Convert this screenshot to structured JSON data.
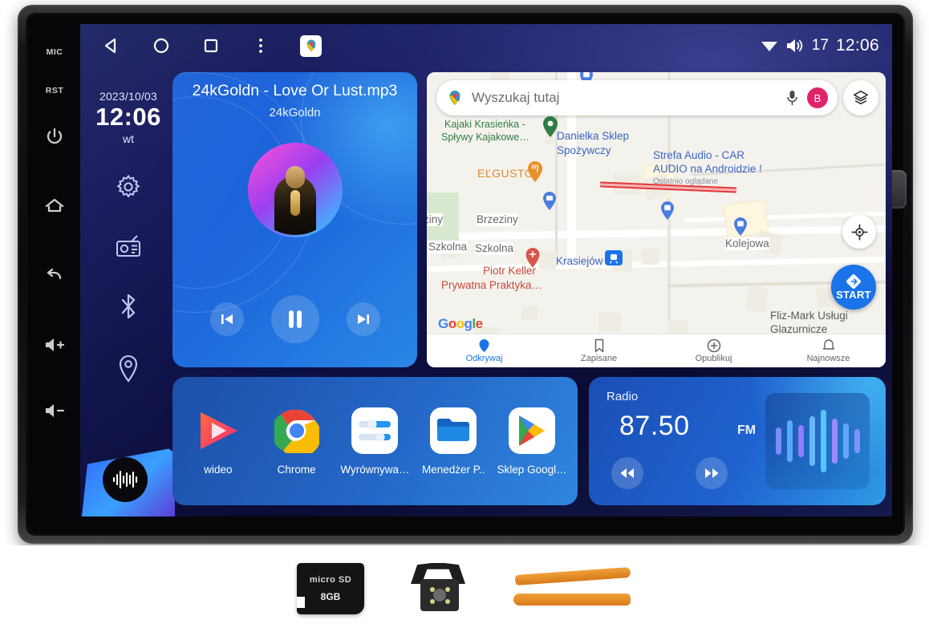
{
  "device": {
    "hardkeys": [
      {
        "name": "mic",
        "label": "MIC"
      },
      {
        "name": "reset",
        "label": "RST"
      },
      {
        "name": "power",
        "label": "power-icon"
      },
      {
        "name": "home",
        "label": "home-icon"
      },
      {
        "name": "back",
        "label": "back-icon"
      },
      {
        "name": "volume-up",
        "label": "volume-up-icon"
      },
      {
        "name": "volume-down",
        "label": "volume-down-icon"
      }
    ]
  },
  "statusbar": {
    "nav": [
      "back-icon",
      "home-circle-icon",
      "recents-square-icon",
      "overflow-menu-icon",
      "google-maps-icon"
    ],
    "wifi_icon": "wifi-icon",
    "volume_icon": "speaker-icon",
    "volume_value": "17",
    "clock": "12:06"
  },
  "sidepanel": {
    "date": "2023/10/03",
    "clock": "12:06",
    "weekday": "wt",
    "icons": [
      "settings-gear-icon",
      "radio-icon",
      "bluetooth-icon",
      "location-pin-icon"
    ],
    "music_widget_icon": "audio-waveform-icon"
  },
  "now_playing": {
    "title": "24kGoldn - Love Or Lust.mp3",
    "artist": "24kGoldn",
    "prev_label": "previous-track",
    "play_label": "pause",
    "next_label": "next-track"
  },
  "map": {
    "search_placeholder": "Wyszukaj tutaj",
    "mic_icon": "microphone-icon",
    "avatar_initial": "B",
    "layers_icon": "map-layers-icon",
    "recenter_icon": "recenter-icon",
    "start_label": "START",
    "watermark": "Google",
    "labels": [
      {
        "text": "Kajaki Krasieńka -",
        "kind": "green"
      },
      {
        "text": "Spływy Kajakowe…",
        "kind": "green"
      },
      {
        "text": "Danielka Sklep",
        "kind": "blue"
      },
      {
        "text": "Spożywczy",
        "kind": "blue"
      },
      {
        "text": "Strefa Audio - CAR",
        "kind": "blue"
      },
      {
        "text": "AUDIO na Androidzie !",
        "kind": "blue"
      },
      {
        "text": "Ostatnio oglądane",
        "kind": "sub"
      },
      {
        "text": "EĽGUSTO",
        "kind": "orange"
      },
      {
        "text": "Brzeziny",
        "kind": "road"
      },
      {
        "text": "ziny",
        "kind": "road"
      },
      {
        "text": "Szkolna",
        "kind": "road"
      },
      {
        "text": "Szkolna",
        "kind": "road"
      },
      {
        "text": "Kolejowa",
        "kind": "road"
      },
      {
        "text": "Piotr Keller",
        "kind": "red"
      },
      {
        "text": "Prywatna Praktyka…",
        "kind": "red"
      },
      {
        "text": "Krasiejów",
        "kind": "blue"
      },
      {
        "text": "Fliz-Mark Usługi",
        "kind": "dark"
      },
      {
        "text": "Glazurnicze",
        "kind": "dark"
      }
    ],
    "bottom_nav": [
      {
        "label": "Odkrywaj",
        "icon": "location-pin-icon",
        "active": true
      },
      {
        "label": "Zapisane",
        "icon": "bookmark-icon",
        "active": false
      },
      {
        "label": "Opublikuj",
        "icon": "plus-circle-icon",
        "active": false
      },
      {
        "label": "Najnowsze",
        "icon": "bell-icon",
        "active": false
      }
    ]
  },
  "apps": [
    {
      "label": "wideo",
      "icon": "video-player-icon"
    },
    {
      "label": "Chrome",
      "icon": "chrome-icon"
    },
    {
      "label": "Wyrównywa…",
      "icon": "equalizer-icon"
    },
    {
      "label": "Menedżer P..",
      "icon": "file-manager-icon"
    },
    {
      "label": "Sklep Googl…",
      "icon": "google-play-icon"
    }
  ],
  "radio": {
    "title": "Radio",
    "frequency": "87.50",
    "band": "FM",
    "prev_icon": "rewind-icon",
    "next_icon": "fast-forward-icon",
    "visual_icon": "audio-waveform-icon",
    "bars": [
      34,
      52,
      40,
      62,
      78,
      56,
      44,
      30
    ]
  },
  "accessories": [
    {
      "name": "microsd-card",
      "logo": "micro SD",
      "capacity": "8GB"
    },
    {
      "name": "reversing-camera",
      "logo": "",
      "capacity": ""
    },
    {
      "name": "trim-removal-tools",
      "logo": "",
      "capacity": ""
    }
  ],
  "colors": {
    "accent_blue": "#2f86df",
    "maps_blue": "#1a73e8",
    "radio_bar": "#6ea8ff",
    "screen_bg": "#0e1148"
  }
}
